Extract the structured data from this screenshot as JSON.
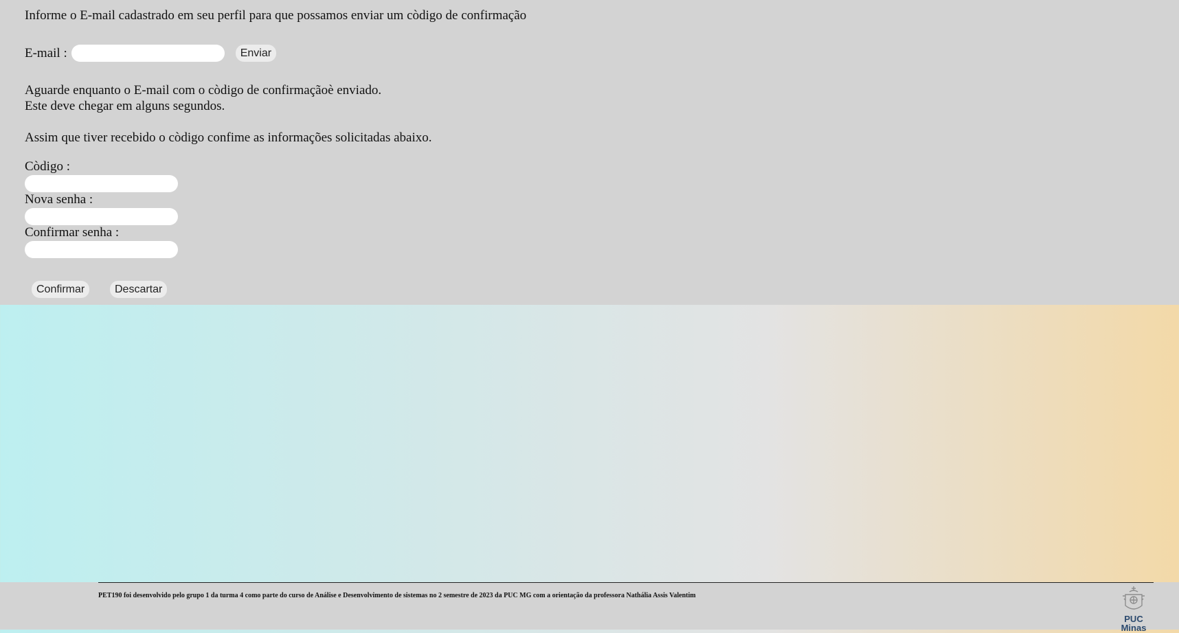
{
  "form": {
    "intro": "Informe o E-mail cadastrado em seu perfil para que possamos enviar um còdigo de confirmação",
    "email_label": "E-mail :",
    "email_value": "",
    "send_label": "Enviar",
    "wait_line1": "Aguarde enquanto o E-mail com o còdigo de confirmaçãoè enviado.",
    "wait_line2": "Este deve chegar em alguns segundos.",
    "assim": "Assim que tiver recebido o còdigo confime as informações solicitadas abaixo.",
    "code_label": "Còdigo :",
    "code_value": "",
    "new_password_label": "Nova senha :",
    "new_password_value": "",
    "confirm_password_label": "Confirmar senha :",
    "confirm_password_value": "",
    "confirm_label": "Confirmar",
    "discard_label": "Descartar"
  },
  "footer": {
    "text": "PET190 foi desenvolvido pelo grupo 1 da turma 4 como parte do curso de Análise e Desenvolvimento de sistemas no 2 semestre de 2023 da PUC MG com a orientação da professora Nathália Assis Valentim",
    "logo_text": "PUC Minas",
    "logo_icon": "puc-minas-crest-icon"
  },
  "colors": {
    "panel": "#d3d3d3",
    "gradient_left": "#bdeff0",
    "gradient_mid": "#e3e3e3",
    "gradient_right": "#f3d9a8",
    "logo": "#2c4a6e"
  }
}
